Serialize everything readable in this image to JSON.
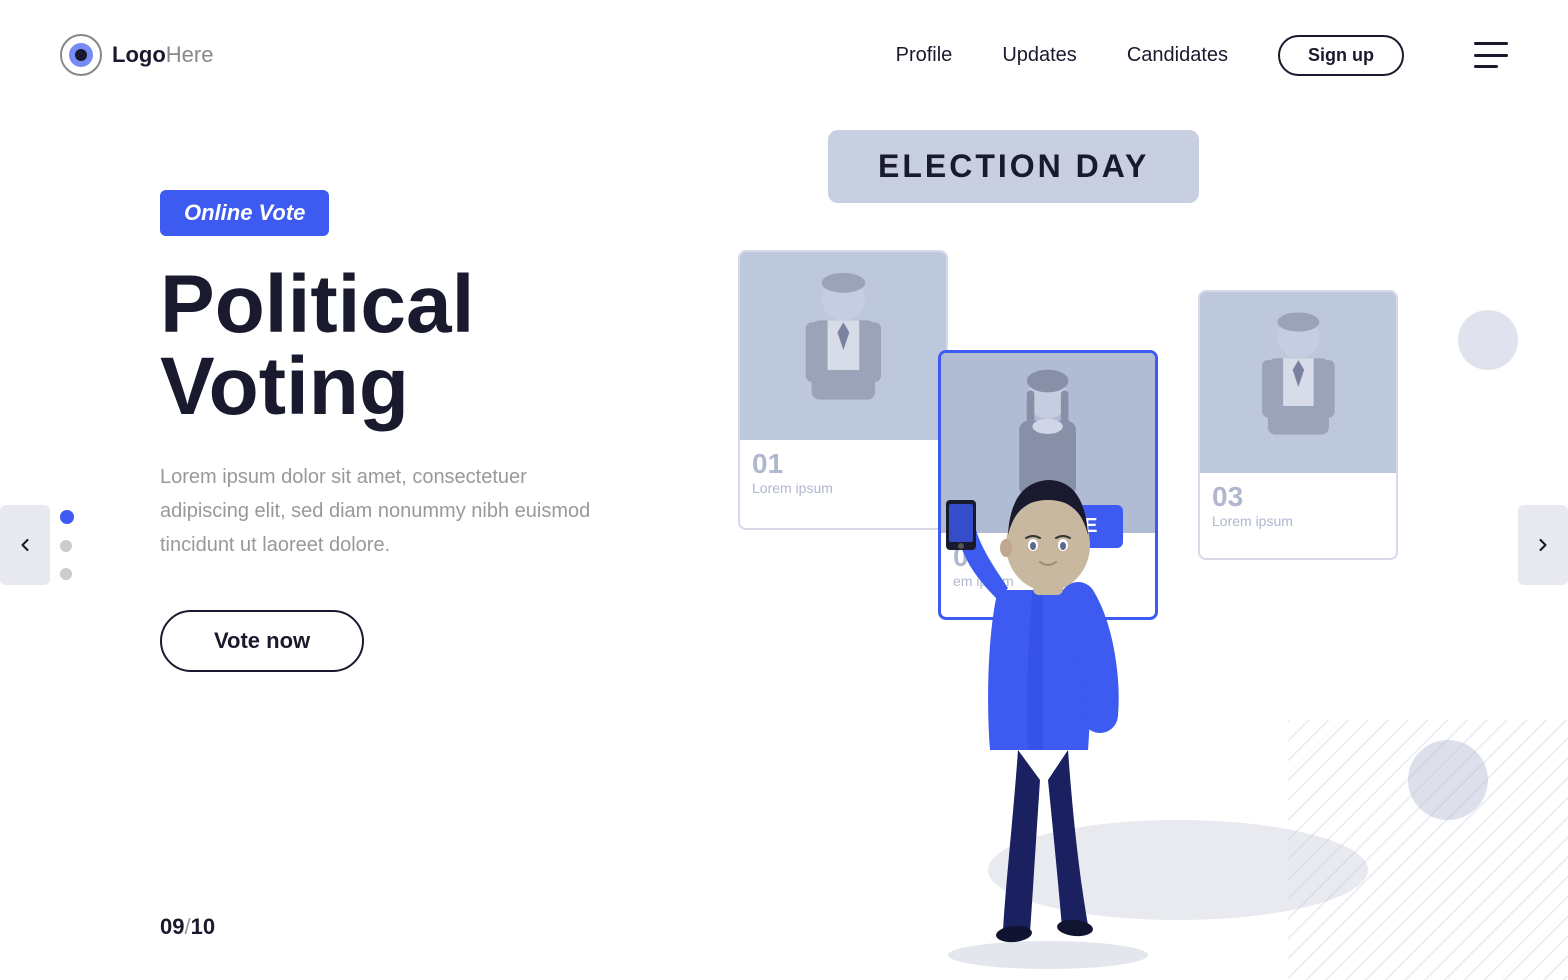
{
  "header": {
    "logo_text": "Logo",
    "logo_here": "Here",
    "nav": {
      "profile": "Profile",
      "updates": "Updates",
      "candidates": "Candidates",
      "signup": "Sign up"
    }
  },
  "hero": {
    "badge": "Online Vote",
    "title_line1": "Political",
    "title_line2": "Voting",
    "description": "Lorem ipsum dolor sit amet, consectetuer adipiscing elit, sed diam nonummy nibh euismod tincidunt ut laoreet dolore.",
    "cta_button": "Vote now",
    "page_current": "09",
    "page_total": "10"
  },
  "election": {
    "banner_text": "ELECTION DAY"
  },
  "candidates": [
    {
      "number": "01",
      "label": "Lorem ipsum"
    },
    {
      "number": "02",
      "label": "em ipsum"
    },
    {
      "number": "03",
      "label": "Lorem ipsum"
    }
  ],
  "vote_tag": "VOTE",
  "colors": {
    "primary": "#3d5af1",
    "dark": "#1a1a2e",
    "muted": "#999999",
    "card_bg": "#c8cfe0",
    "accent_light": "#e8eaf0"
  }
}
